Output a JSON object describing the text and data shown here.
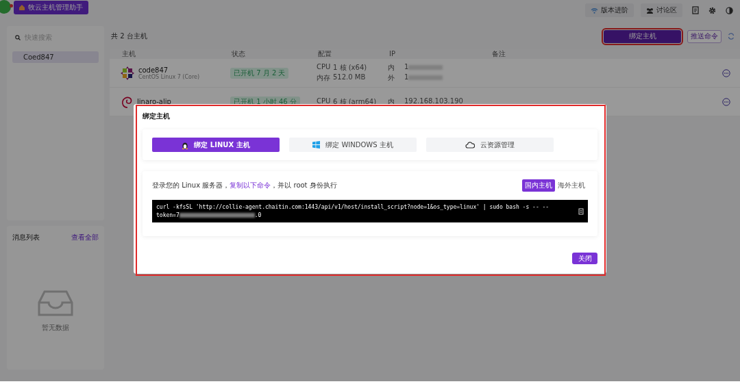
{
  "app": {
    "title": "牧云主机管理助手",
    "badge_dot": true
  },
  "topbar": {
    "links": [
      {
        "label": "版本进阶",
        "kind": "wifi"
      },
      {
        "label": "讨论区",
        "kind": "people"
      }
    ]
  },
  "sidebar": {
    "search": {
      "placeholder": "快速搜索"
    },
    "items": [
      {
        "label": "Coed847",
        "selected": true
      }
    ]
  },
  "messages": {
    "title": "消息列表",
    "view_all": "查看全部",
    "empty": "暂无数据"
  },
  "main": {
    "count": "共 2 台主机",
    "buttons": [
      {
        "label": "绑定主机",
        "kind": "primary",
        "highlighted": true
      },
      {
        "label": "推送命令",
        "kind": "outline",
        "highlighted": false
      }
    ]
  },
  "table": {
    "columns": [
      "主机",
      "状态",
      "配置",
      "IP",
      "备注"
    ],
    "rows": [
      {
        "name": "code847",
        "os": "CentOS Linux 7 (Core)",
        "status": "已开机 7 月 2 天",
        "config": [
          [
            "CPU",
            "1 核 (x64)"
          ],
          [
            "内存",
            "512.0 MB"
          ]
        ],
        "ip": [
          {
            "label": "内",
            "value": "1",
            "blurred": true
          },
          {
            "label": "外",
            "value": "1",
            "blurred": true
          }
        ]
      },
      {
        "name": "linaro-alip",
        "status": "已开机 1 小时 46 分",
        "config": [
          [
            "CPU",
            "6 核 (arm64)"
          ]
        ],
        "ip": [
          {
            "label": "内",
            "value": "192.168.103.190",
            "blurred": false
          }
        ]
      }
    ]
  },
  "dialog": {
    "title": "绑定主机",
    "annotated": true,
    "tabs": [
      {
        "label": "绑定 LINUX 主机",
        "kind": "linux",
        "selected": true
      },
      {
        "label": "绑定 WINDOWS 主机",
        "kind": "windows",
        "selected": false
      },
      {
        "label": "云资源管理",
        "kind": "cloud",
        "selected": false
      }
    ],
    "instruction": {
      "before": "登录您的 Linux 服务器，",
      "link": "复制以下命令",
      "after": "，并以 root 身份执行"
    },
    "regions": [
      {
        "label": "国内主机",
        "selected": true
      },
      {
        "label": "海外主机",
        "selected": false
      }
    ],
    "command": "curl -kfsSL 'http://collie-agent.chaitin.com:1443/api/v1/host/install_script?node=1&os_type=linux' | sudo bash -s -- --",
    "token": {
      "start": "token=7",
      "end": ".0"
    },
    "close": "关闭"
  }
}
